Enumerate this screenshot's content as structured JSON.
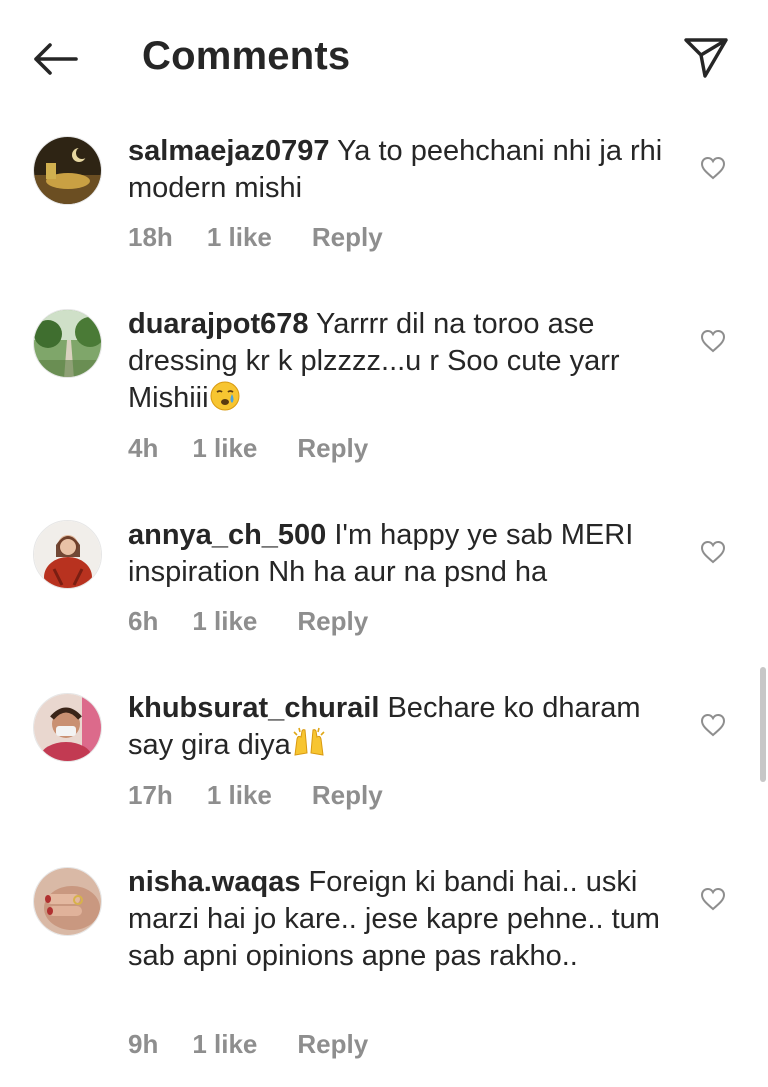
{
  "header": {
    "title": "Comments",
    "back_icon": "arrow-left-icon",
    "send_icon": "paper-plane-icon"
  },
  "comments": [
    {
      "username": "salmaejaz0797",
      "text": "Ya to peehchani nhi ja rhi modern mishi",
      "emoji": "",
      "time": "18h",
      "likes": "1 like",
      "reply": "Reply"
    },
    {
      "username": "duarajpot678",
      "text": "Yarrrr dil na toroo ase dressing kr k plzzzz...u r Soo cute yarr Mishiii",
      "emoji": "crying-face",
      "time": "4h",
      "likes": "1 like",
      "reply": "Reply"
    },
    {
      "username": "annya_ch_500",
      "text": "I'm happy ye sab MERI inspiration Nh ha aur na psnd ha",
      "emoji": "",
      "time": "6h",
      "likes": "1 like",
      "reply": "Reply"
    },
    {
      "username": "khubsurat_churail",
      "text": "Bechare ko dharam say gira diya",
      "emoji": "raising-hands",
      "time": "17h",
      "likes": "1 like",
      "reply": "Reply"
    },
    {
      "username": "nisha.waqas",
      "text": "Foreign ki bandi hai.. uski marzi hai jo kare.. jese kapre pehne.. tum sab apni opinions apne pas rakho..",
      "emoji": "",
      "time": "9h",
      "likes": "1 like",
      "reply": "Reply"
    }
  ],
  "colors": {
    "text": "#262626",
    "meta": "#8e8e8e",
    "background": "#ffffff"
  }
}
